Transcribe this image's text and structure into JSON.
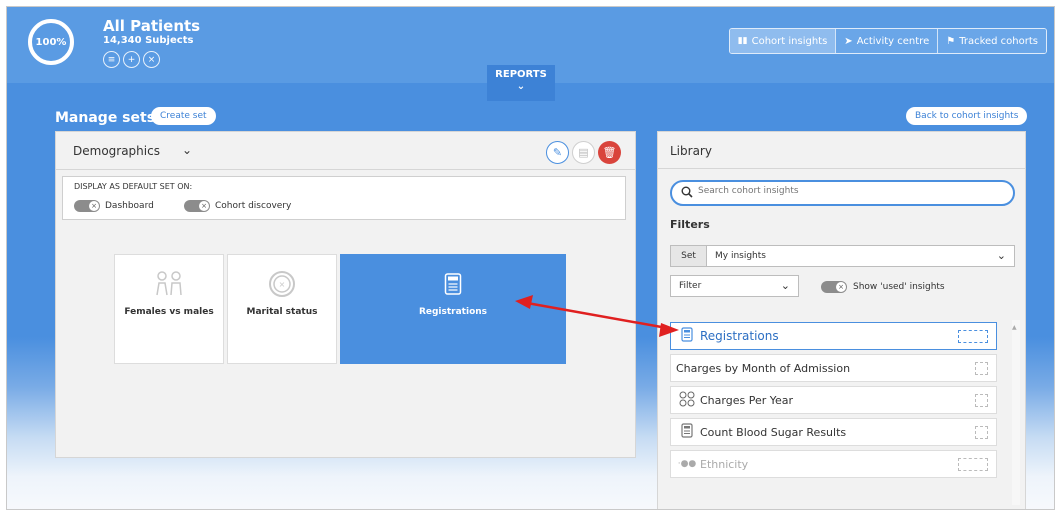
{
  "header": {
    "percent": "100%",
    "title": "All Patients",
    "subjects": "14,340 Subjects",
    "icons": [
      "rows-icon",
      "add-icon",
      "remove-icon"
    ],
    "reports_label": "REPORTS",
    "nav": [
      {
        "label": "Cohort insights",
        "icon": "bar-chart-icon",
        "active": true
      },
      {
        "label": "Activity centre",
        "icon": "send-icon",
        "active": false
      },
      {
        "label": "Tracked cohorts",
        "icon": "flag-icon",
        "active": false
      }
    ]
  },
  "manage": {
    "title": "Manage sets",
    "create_label": "Create set",
    "back_label": "Back to cohort insights"
  },
  "set_panel": {
    "set_name": "Demographics",
    "default_label": "DISPLAY AS DEFAULT SET ON:",
    "toggles": [
      {
        "label": "Dashboard",
        "on": false
      },
      {
        "label": "Cohort discovery",
        "on": false
      }
    ],
    "cards": [
      {
        "label": "Females vs males",
        "icon": "people-icon",
        "active": false
      },
      {
        "label": "Marital status",
        "icon": "ring-icon",
        "active": false
      },
      {
        "label": "Registrations",
        "icon": "calendar-icon",
        "active": true
      }
    ]
  },
  "library": {
    "title": "Library",
    "search_placeholder": "Search cohort insights",
    "filters_title": "Filters",
    "set_tag": "Set",
    "set_value": "My insights",
    "filter_value": "Filter",
    "show_used_label": "Show 'used' insights",
    "items": [
      {
        "label": "Registrations",
        "icon": "calendar-icon",
        "state": "active"
      },
      {
        "label": "Charges by Month of Admission",
        "icon": "",
        "state": "normal"
      },
      {
        "label": "Charges Per Year",
        "icon": "clock-grid-icon",
        "state": "normal"
      },
      {
        "label": "Count Blood Sugar Results",
        "icon": "calendar-icon",
        "state": "normal"
      },
      {
        "label": "Ethnicity",
        "icon": "dots-icon",
        "state": "faded"
      }
    ]
  },
  "colors": {
    "brand_blue": "#4a8fdf",
    "header_blue": "#5a9be3",
    "delete_red": "#d9443c",
    "arrow_red": "#e02020"
  }
}
